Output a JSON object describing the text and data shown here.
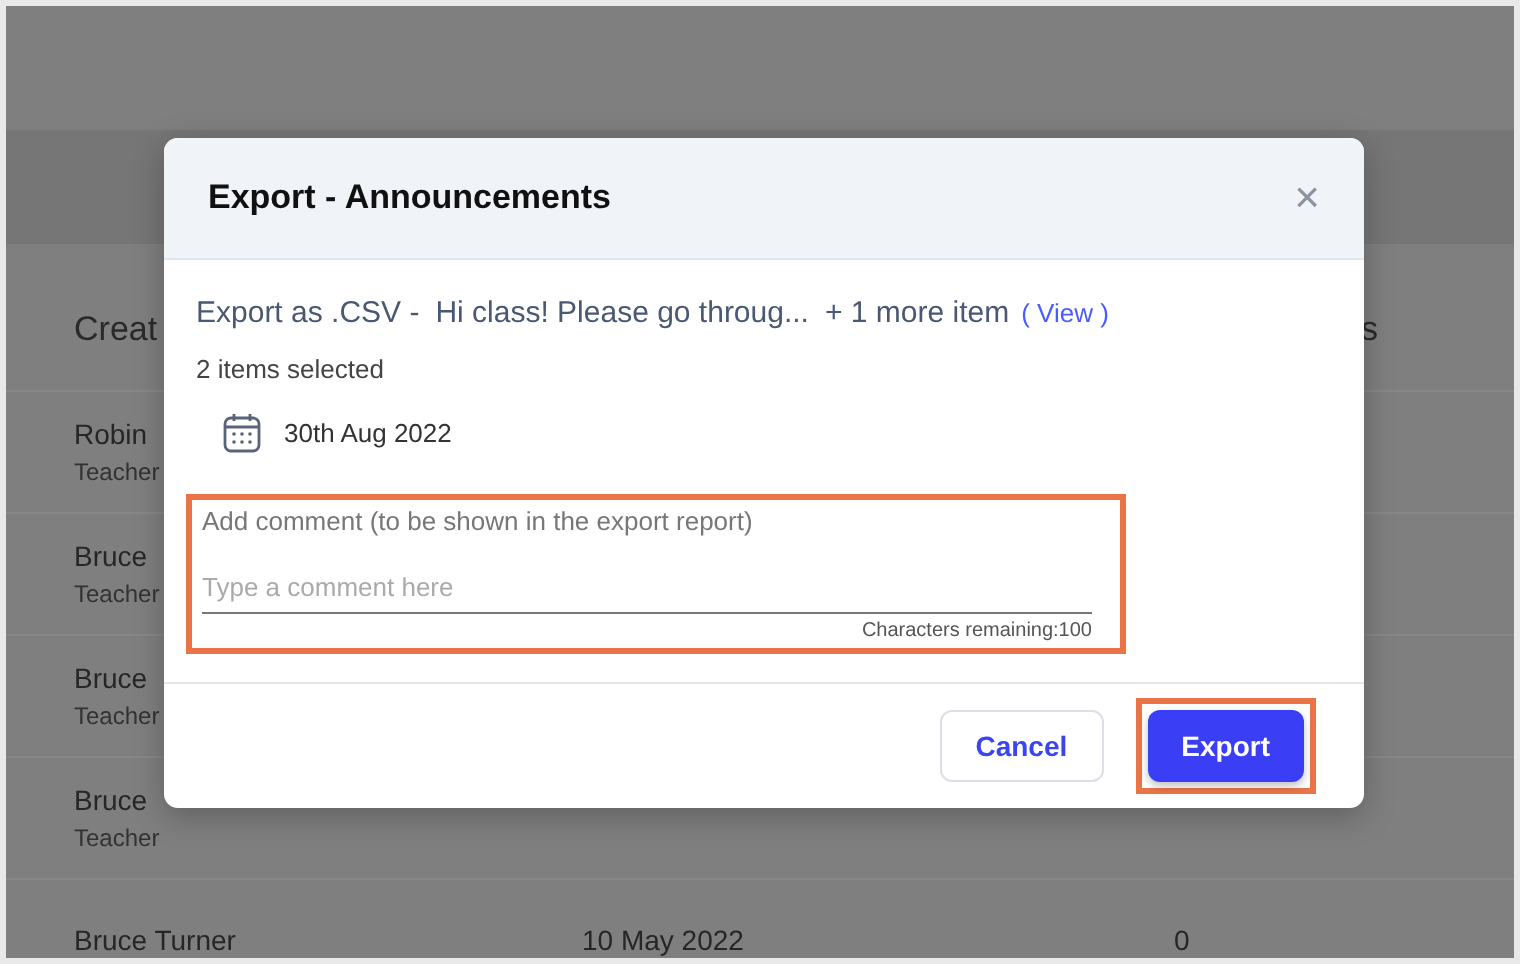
{
  "background_table": {
    "columns": [
      {
        "label": "Creat"
      },
      {
        "label": "s"
      }
    ],
    "rows": [
      {
        "name": "Robin",
        "role": "Teacher",
        "date": "",
        "count": ""
      },
      {
        "name": "Bruce",
        "role": "Teacher",
        "date": "",
        "count": ""
      },
      {
        "name": "Bruce",
        "role": "Teacher",
        "date": "",
        "count": ""
      },
      {
        "name": "Bruce",
        "role": "Teacher",
        "date": "",
        "count": ""
      },
      {
        "name": "Bruce Turner",
        "role": "",
        "date": "10 May 2022",
        "count": "0"
      }
    ]
  },
  "dialog": {
    "title": "Export - Announcements",
    "close": "×",
    "summary": {
      "format": "Export as .CSV -",
      "item": "Hi class! Please go throug...",
      "more": "+ 1 more item",
      "link": "( View )"
    },
    "selected_count": "2 items selected",
    "date": "30th Aug 2022",
    "comment": {
      "label": "Add comment (to be shown in the export report)",
      "placeholder": "Type a comment here",
      "remaining": "Characters remaining:100",
      "highlighted": true
    },
    "buttons": [
      {
        "label": "Cancel",
        "kind": "secondary",
        "highlighted": false
      },
      {
        "label": "Export",
        "kind": "primary",
        "highlighted": true
      }
    ]
  }
}
